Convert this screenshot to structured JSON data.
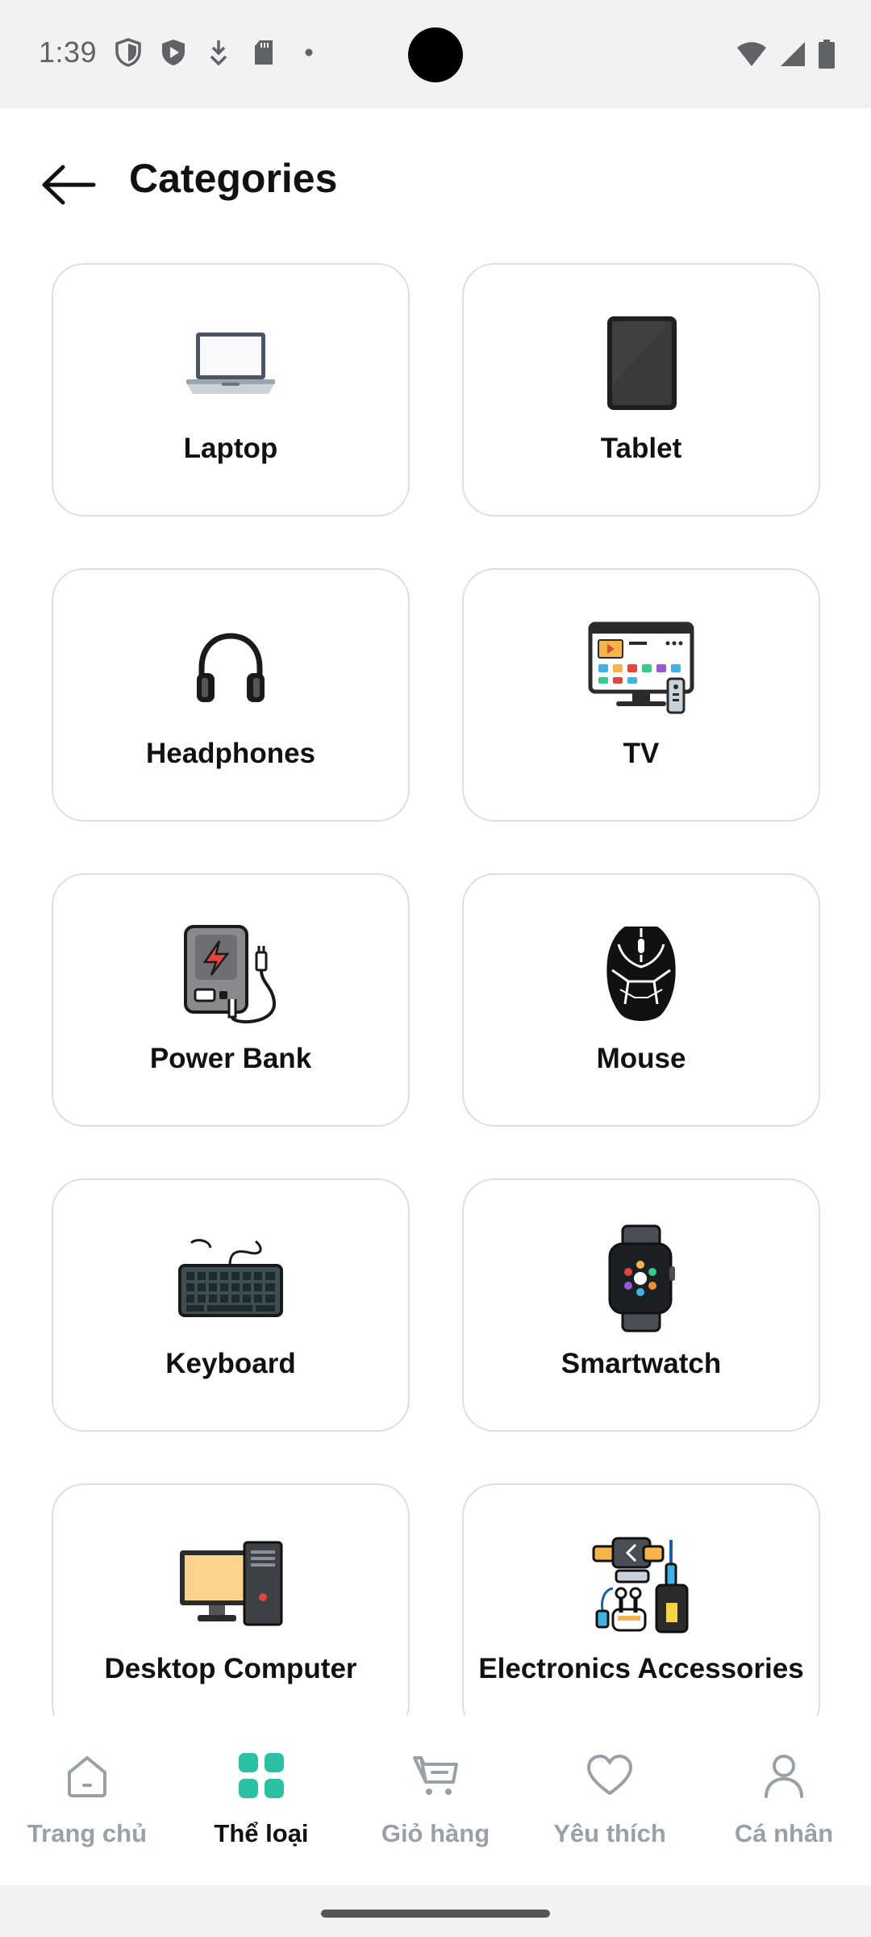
{
  "status_bar": {
    "time": "1:39",
    "left_icons": [
      "shield-icon",
      "play-protect-icon",
      "download-icon",
      "sd-card-icon",
      "dot-icon"
    ],
    "right_icons": [
      "wifi-icon",
      "signal-icon",
      "battery-icon"
    ]
  },
  "header": {
    "title": "Categories",
    "back_icon": "arrow-left-icon"
  },
  "categories": [
    {
      "label": "Laptop",
      "icon": "laptop-icon"
    },
    {
      "label": "Tablet",
      "icon": "tablet-icon"
    },
    {
      "label": "Headphones",
      "icon": "headphones-icon"
    },
    {
      "label": "TV",
      "icon": "tv-icon"
    },
    {
      "label": "Power Bank",
      "icon": "power-bank-icon"
    },
    {
      "label": "Mouse",
      "icon": "mouse-icon"
    },
    {
      "label": "Keyboard",
      "icon": "keyboard-icon"
    },
    {
      "label": "Smartwatch",
      "icon": "smartwatch-icon"
    },
    {
      "label": "Desktop Computer",
      "icon": "desktop-computer-icon"
    },
    {
      "label": "Electronics Accessories",
      "icon": "accessories-icon"
    }
  ],
  "bottom_nav": {
    "active_index": 1,
    "items": [
      {
        "label": "Trang chủ",
        "icon": "home-icon"
      },
      {
        "label": "Thể loại",
        "icon": "grid-icon"
      },
      {
        "label": "Giỏ hàng",
        "icon": "cart-icon"
      },
      {
        "label": "Yêu thích",
        "icon": "heart-icon"
      },
      {
        "label": "Cá nhân",
        "icon": "person-icon"
      }
    ]
  },
  "colors": {
    "accent": "#2bbfa4",
    "inactive": "#9aa0a8",
    "card_border": "#dedede"
  }
}
